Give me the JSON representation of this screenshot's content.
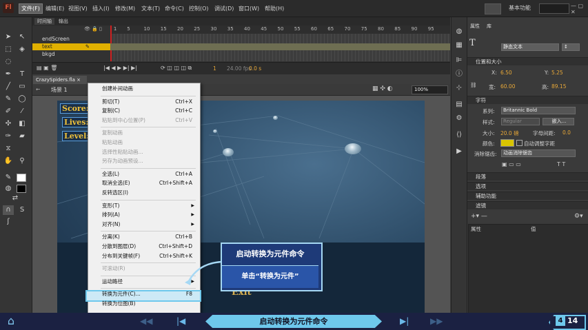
{
  "app": {
    "logo": "Fl",
    "menus": [
      "文件(F)",
      "编辑(E)",
      "视图(V)",
      "插入(I)",
      "修改(M)",
      "文本(T)",
      "命令(C)",
      "控制(O)",
      "调试(D)",
      "窗口(W)",
      "帮助(H)"
    ],
    "active_menu": 0,
    "workspace": "基本功能",
    "window_controls": "— ▢ ✕"
  },
  "timeline": {
    "tabs": [
      "时间轴",
      "输出"
    ],
    "layers": [
      {
        "name": "endScreen",
        "selected": false
      },
      {
        "name": "text",
        "selected": true
      },
      {
        "name": "bkgd",
        "selected": false
      }
    ],
    "ticks": [
      "1",
      "5",
      "10",
      "15",
      "20",
      "25",
      "30",
      "35",
      "40",
      "45",
      "50",
      "55",
      "60",
      "65",
      "70",
      "75",
      "80",
      "85",
      "90",
      "95"
    ],
    "frame_number": "1",
    "fps": "24.00 fps",
    "time": "0.0 s"
  },
  "document": {
    "tab": "CrazySpiders.fla",
    "close": "×",
    "scene": "场景 1",
    "zoom": "100%"
  },
  "stage": {
    "hud": [
      "Score:",
      "Lives:",
      "Level:"
    ],
    "exit": "Exit"
  },
  "context_menu": {
    "items": [
      {
        "label": "创建补间动画",
        "shortcut": "",
        "disabled": false,
        "arrow": false
      },
      {
        "sep": true
      },
      {
        "label": "剪切(T)",
        "shortcut": "Ctrl+X",
        "disabled": false,
        "arrow": false
      },
      {
        "label": "复制(C)",
        "shortcut": "Ctrl+C",
        "disabled": false,
        "arrow": false
      },
      {
        "label": "粘贴到中心位置(P)",
        "shortcut": "Ctrl+V",
        "disabled": true,
        "arrow": false
      },
      {
        "sep": true
      },
      {
        "label": "复制动画",
        "shortcut": "",
        "disabled": true,
        "arrow": false
      },
      {
        "label": "粘贴动画",
        "shortcut": "",
        "disabled": true,
        "arrow": false
      },
      {
        "label": "选择性粘贴动画...",
        "shortcut": "",
        "disabled": true,
        "arrow": false
      },
      {
        "label": "另存为动画预设...",
        "shortcut": "",
        "disabled": true,
        "arrow": false
      },
      {
        "sep": true
      },
      {
        "label": "全选(L)",
        "shortcut": "Ctrl+A",
        "disabled": false,
        "arrow": false
      },
      {
        "label": "取消全选(E)",
        "shortcut": "Ctrl+Shift+A",
        "disabled": false,
        "arrow": false
      },
      {
        "label": "反转选区(I)",
        "shortcut": "",
        "disabled": false,
        "arrow": false
      },
      {
        "sep": true
      },
      {
        "label": "变形(T)",
        "shortcut": "",
        "disabled": false,
        "arrow": true
      },
      {
        "label": "排列(A)",
        "shortcut": "",
        "disabled": false,
        "arrow": true
      },
      {
        "label": "对齐(N)",
        "shortcut": "",
        "disabled": false,
        "arrow": true
      },
      {
        "sep": true
      },
      {
        "label": "分离(K)",
        "shortcut": "Ctrl+B",
        "disabled": false,
        "arrow": false
      },
      {
        "label": "分散到图层(D)",
        "shortcut": "Ctrl+Shift+D",
        "disabled": false,
        "arrow": false
      },
      {
        "label": "分布到关键帧(F)",
        "shortcut": "Ctrl+Shift+K",
        "disabled": false,
        "arrow": false
      },
      {
        "sep": true
      },
      {
        "label": "可滚动(R)",
        "shortcut": "",
        "disabled": true,
        "arrow": false
      },
      {
        "sep": true
      },
      {
        "label": "运动路径",
        "shortcut": "",
        "disabled": false,
        "arrow": true
      },
      {
        "sep": true
      },
      {
        "label": "转换为元件(C)...",
        "shortcut": "F8",
        "disabled": false,
        "arrow": false,
        "highlight": true
      },
      {
        "label": "转换为位图(B)",
        "shortcut": "",
        "disabled": false,
        "arrow": false
      }
    ]
  },
  "callout": {
    "title": "启动转换为元件命令",
    "body": "单击“转换为元件”"
  },
  "properties": {
    "tabs": [
      "属性",
      "库"
    ],
    "text_type": "静态文本",
    "sections": {
      "position": "位置和大小",
      "char": "字符",
      "paragraph": "段落",
      "options": "选项",
      "accessibility": "辅助功能",
      "filters": "滤镜"
    },
    "x_label": "X:",
    "x": "6.50",
    "y_label": "Y:",
    "y": "5.25",
    "w_label": "宽:",
    "w": "60.00",
    "h_label": "高:",
    "h": "89.15",
    "family_label": "系列:",
    "family": "Britannic Bold",
    "style_label": "样式:",
    "style": "Regular",
    "embed": "嵌入...",
    "size_label": "大小:",
    "size": "20.0 磅",
    "spacing_label": "字母间距:",
    "spacing": "0.0",
    "color_label": "颜色:",
    "autokern": "自动调整字距",
    "antialias_label": "消除锯齿:",
    "antialias": "动画消除锯齿",
    "filter_col1": "属性",
    "filter_col2": "值"
  },
  "bottom_nav": {
    "title": "启动转换为元件命令",
    "current_page": "4",
    "total_pages": "14"
  },
  "colors": {
    "accent": "#6ec8ec",
    "menu_highlight": "#cde9f6",
    "callout_bg": "#1e3a78",
    "layer_selected": "#e0b000",
    "hud_text": "#f0c23a"
  }
}
